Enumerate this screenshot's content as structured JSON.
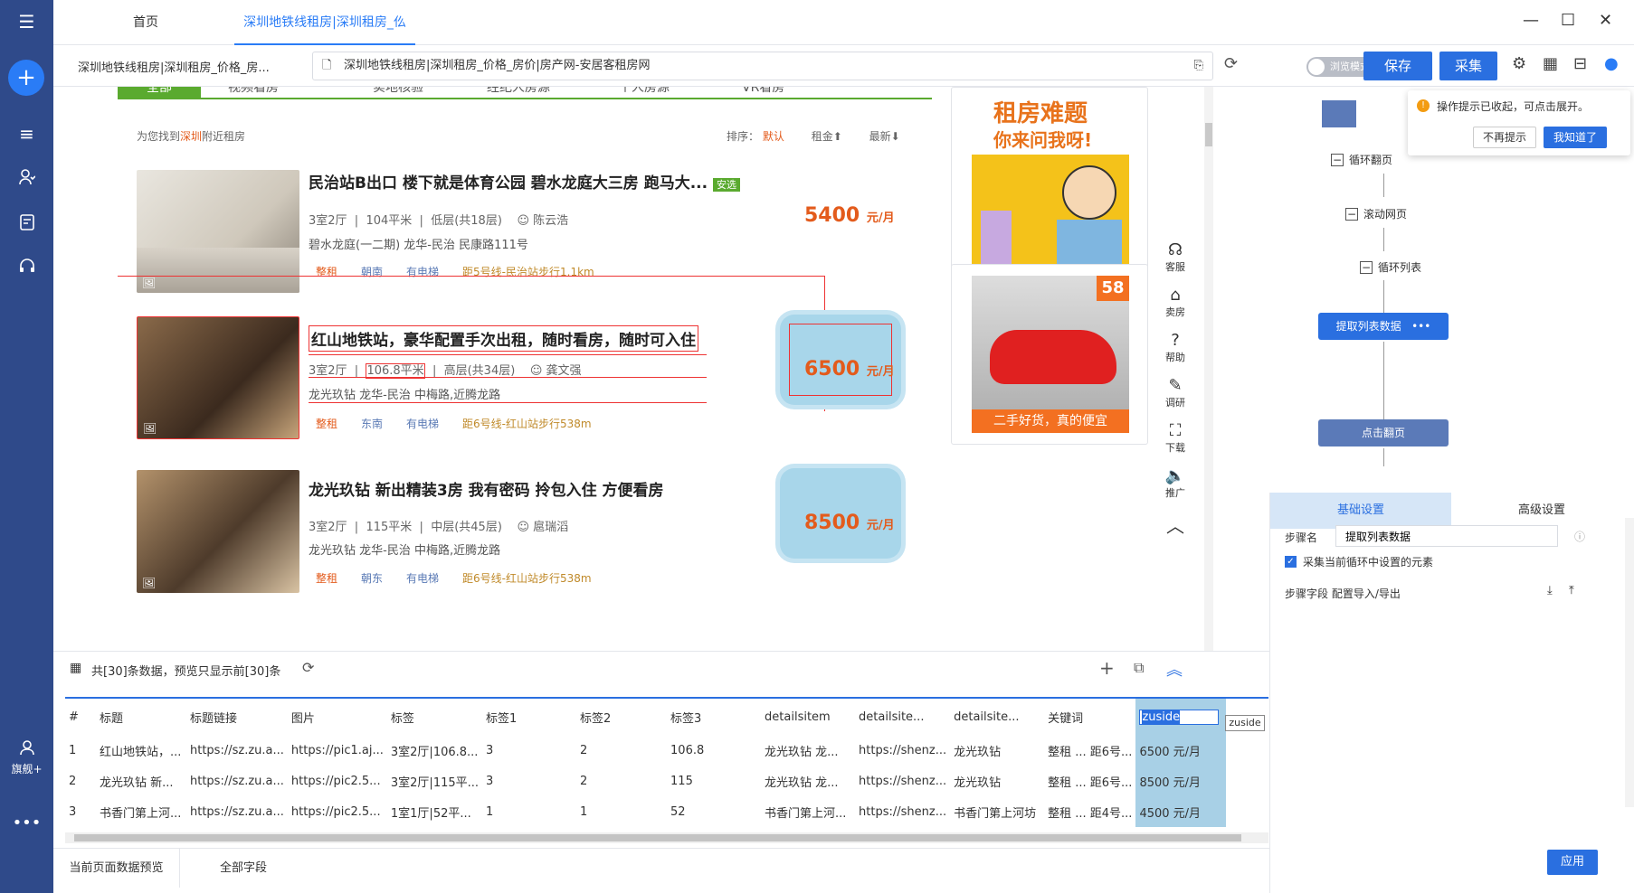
{
  "sidebar": {
    "user_label": "旗舰+"
  },
  "tabs": [
    {
      "label": "首页"
    },
    {
      "label": "深圳地铁线租房|深圳租房_仫"
    }
  ],
  "address": {
    "page_title": "深圳地铁线租房|深圳租房_价格_房...",
    "url": "深圳地铁线租房|深圳租房_价格_房价|房产网-安居客租房网",
    "toggle_label": "浏览模式",
    "save": "保存",
    "collect": "采集"
  },
  "page": {
    "filter_tabs": [
      "全部",
      "视频看房",
      "实地核验",
      "经纪人房源",
      "个人房源",
      "VR看房"
    ],
    "found_text_pre": "为您找到",
    "found_city": "深圳",
    "found_text_post": "附近租房",
    "sort_label": "排序：",
    "sort_default": "默认",
    "sort_rent": "租金",
    "sort_latest": "最新",
    "listings": [
      {
        "title": "民治站B出口 楼下就是体育公园 碧水龙庭大三房 跑马大...",
        "badge": "安选",
        "rooms": "3室2厅",
        "area": "104平米",
        "floor": "低层(共18层)",
        "agent": "陈云浩",
        "address": "碧水龙庭(一二期)  龙华-民治 民康路111号",
        "tags": [
          "整租",
          "朝南",
          "有电梯",
          "距5号线-民治站步行1.1km"
        ],
        "price": "5400",
        "unit": "元/月"
      },
      {
        "title": "红山地铁站，豪华配置手次出租，随时看房，随时可入住",
        "rooms": "3室2厅",
        "area": "106.8平米",
        "floor": "高层(共34层)",
        "agent": "龚文强",
        "address": "龙光玖钻    龙华-民治 中梅路,近腾龙路",
        "tags": [
          "整租",
          "东南",
          "有电梯",
          "距6号线-红山站步行538m"
        ],
        "price": "6500",
        "unit": "元/月"
      },
      {
        "title": "龙光玖钻 新出精装3房 我有密码 拎包入住 方便看房",
        "rooms": "3室2厅",
        "area": "115平米",
        "floor": "中层(共45层)",
        "agent": "扈瑞滔",
        "address": "龙光玖钻    龙华-民治 中梅路,近腾龙路",
        "tags": [
          "整租",
          "朝东",
          "有电梯",
          "距6号线-红山站步行538m"
        ],
        "price": "8500",
        "unit": "元/月"
      }
    ],
    "ad1_line1": "租房难题",
    "ad1_line2": "你来问我呀!",
    "ad2_badge": "58",
    "ad2_text": "二手好货，真的便宜",
    "vtools": [
      "客服",
      "卖房",
      "帮助",
      "调研",
      "下载",
      "推广"
    ]
  },
  "flow": {
    "tips_text": "操作提示已收起，可点击展开。",
    "tips_no": "不再提示",
    "tips_ok": "我知道了",
    "items": [
      "循环翻页",
      "滚动网页",
      "循环列表"
    ],
    "extract": "提取列表数据",
    "click_page": "点击翻页"
  },
  "settings": {
    "tab_basic": "基础设置",
    "tab_advanced": "高级设置",
    "step_name_label": "步骤名",
    "step_name_value": "提取列表数据",
    "checkbox_label": "采集当前循环中设置的元素",
    "fields_label": "步骤字段 配置导入/导出",
    "apply": "应用"
  },
  "preview": {
    "summary": "共[30]条数据，预览只显示前[30]条",
    "columns": [
      "#",
      "标题",
      "标题链接",
      "图片",
      "标签",
      "标签1",
      "标签2",
      "标签3",
      "detailsitem",
      "detailsite...",
      "detailsite...",
      "关键词",
      "zuside"
    ],
    "tooltip": "zuside",
    "rows": [
      [
        "1",
        "红山地铁站，...",
        "https://sz.zu.a...",
        "https://pic1.aj...",
        "3室2厅|106.8...",
        "3",
        "2",
        "106.8",
        "龙光玖钻   龙...",
        "https://shenz...",
        "龙光玖钻",
        "整租 ... 距6号...",
        "6500 元/月"
      ],
      [
        "2",
        "龙光玖钻 新...",
        "https://sz.zu.a...",
        "https://pic2.5...",
        "3室2厅|115平...",
        "3",
        "2",
        "115",
        "龙光玖钻   龙...",
        "https://shenz...",
        "龙光玖钻",
        "整租 ... 距6号...",
        "8500 元/月"
      ],
      [
        "3",
        "书香门第上河...",
        "https://sz.zu.a...",
        "https://pic2.5...",
        "1室1厅|52平...",
        "1",
        "1",
        "52",
        "书香门第上河...",
        "https://shenz...",
        "书香门第上河坊",
        "整租 ... 距4号...",
        "4500 元/月"
      ]
    ],
    "tab_current": "当前页面数据预览",
    "tab_all": "全部字段"
  }
}
